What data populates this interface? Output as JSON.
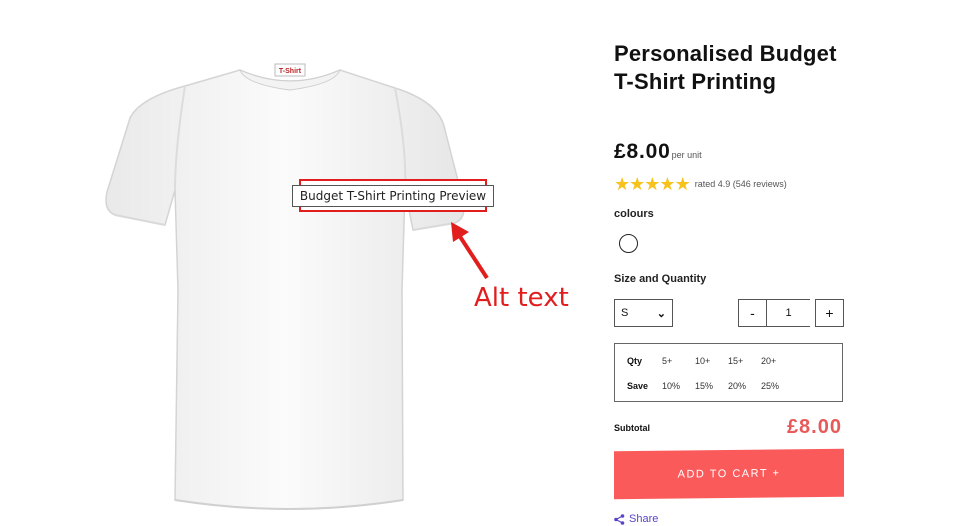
{
  "product": {
    "title": "Personalised Budget T-Shirt Printing",
    "price": "£8.00",
    "price_unit": "per unit",
    "rating_text": "rated 4.9 (546 reviews)",
    "rating_value": 4.9,
    "stars": 5,
    "colours_label": "colours",
    "swatch_color": "#ffffff"
  },
  "image": {
    "alt_text": "Budget T-Shirt  Printing Preview",
    "neck_label": "T-Shirt"
  },
  "annotation": {
    "label": "Alt text",
    "color": "#e21d1d"
  },
  "size_qty": {
    "label": "Size and Quantity",
    "size_value": "S",
    "decrement": "-",
    "quantity": "1",
    "increment": "+"
  },
  "discounts": {
    "qty_label": "Qty",
    "save_label": "Save",
    "qty": [
      "5+",
      "10+",
      "15+",
      "20+"
    ],
    "save": [
      "10%",
      "15%",
      "20%",
      "25%"
    ]
  },
  "subtotal": {
    "label": "Subtotal",
    "value": "£8.00",
    "color": "#e85a5a"
  },
  "cart": {
    "button_label": "ADD TO CART +",
    "color": "#fb5a5b"
  },
  "share": {
    "label": "Share",
    "icon": "share-icon"
  }
}
